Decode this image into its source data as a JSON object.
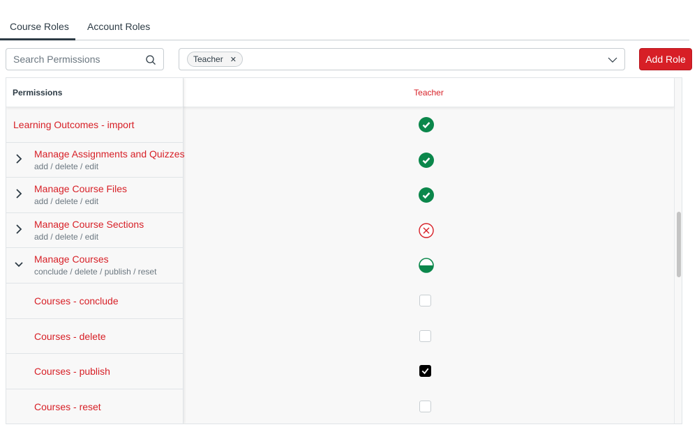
{
  "tabs": [
    {
      "label": "Course Roles",
      "active": true
    },
    {
      "label": "Account Roles",
      "active": false
    }
  ],
  "search": {
    "placeholder": "Search Permissions",
    "value": ""
  },
  "role_filter": {
    "selected": [
      "Teacher"
    ]
  },
  "add_role_label": "Add Role",
  "colors": {
    "brand": "#d71f26",
    "enabled": "#0b874b",
    "disabled": "#d71f26"
  },
  "table": {
    "header_left": "Permissions",
    "roles": [
      "Teacher"
    ],
    "rows": [
      {
        "title": "Learning Outcomes - import",
        "subtitle": "",
        "kind": "single",
        "status": "enabled"
      },
      {
        "title": "Manage Assignments and Quizzes",
        "subtitle": "add / delete / edit",
        "kind": "group",
        "expanded": false,
        "status": "enabled"
      },
      {
        "title": "Manage Course Files",
        "subtitle": "add / delete / edit",
        "kind": "group",
        "expanded": false,
        "status": "enabled"
      },
      {
        "title": "Manage Course Sections",
        "subtitle": "add / delete / edit",
        "kind": "group",
        "expanded": false,
        "status": "disabled"
      },
      {
        "title": "Manage Courses",
        "subtitle": "conclude / delete / publish / reset",
        "kind": "group",
        "expanded": true,
        "status": "partial"
      },
      {
        "title": "Courses - conclude",
        "subtitle": "",
        "kind": "child",
        "checked": false
      },
      {
        "title": "Courses - delete",
        "subtitle": "",
        "kind": "child",
        "checked": false
      },
      {
        "title": "Courses - publish",
        "subtitle": "",
        "kind": "child",
        "checked": true
      },
      {
        "title": "Courses - reset",
        "subtitle": "",
        "kind": "child",
        "checked": false
      }
    ]
  }
}
